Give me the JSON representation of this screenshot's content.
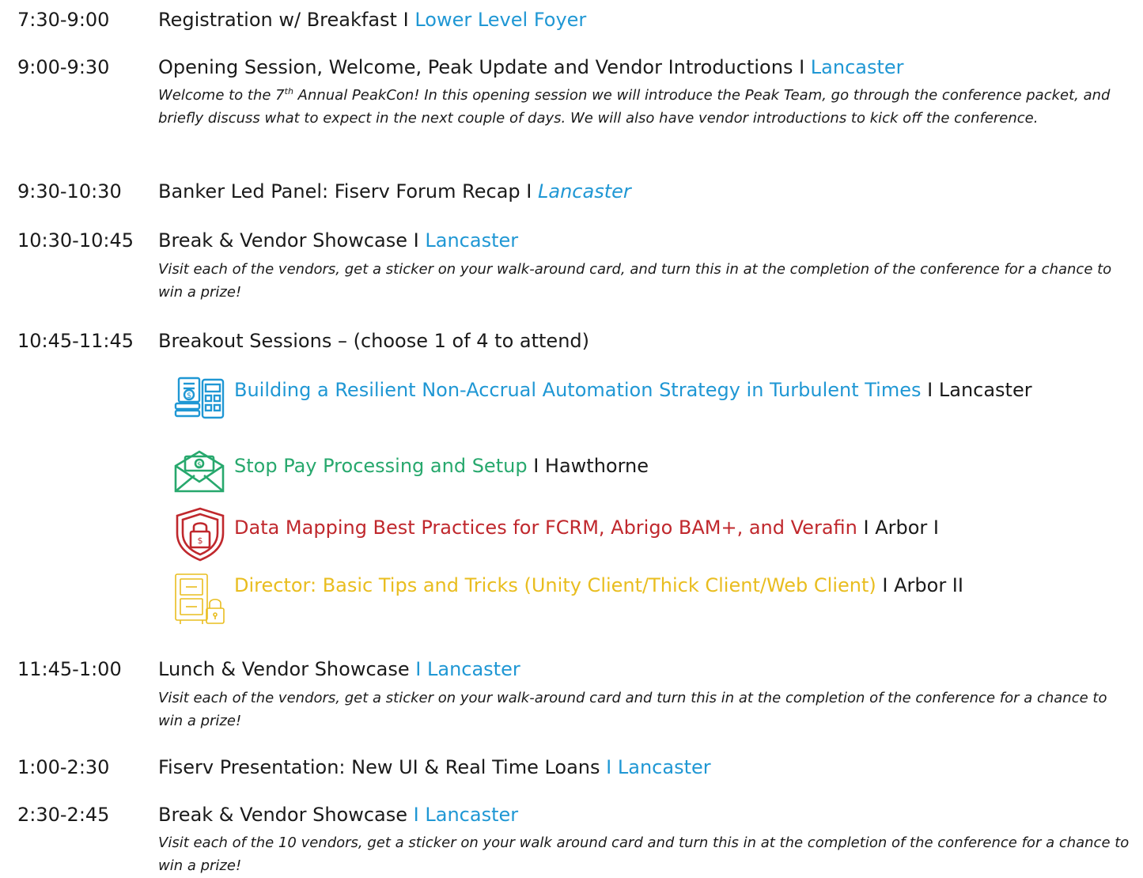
{
  "schedule": [
    {
      "time": "7:30-9:00",
      "title": "Registration w/ Breakfast",
      "sep": "I",
      "location": "Lower Level Foyer"
    },
    {
      "time": "9:00-9:30",
      "title": "Opening Session, Welcome, Peak Update and Vendor Introductions I",
      "location": "Lancaster",
      "desc_a": "Welcome to the 7",
      "desc_sup": "th",
      "desc_b": " Annual PeakCon!  In this opening session we will introduce the Peak Team, go through the conference packet, and briefly discuss what to expect in the next couple of days.  We will also have vendor introductions to kick off the conference."
    },
    {
      "time": "9:30-10:30",
      "title": "Banker Led Panel: Fiserv Forum Recap",
      "sep": "I",
      "location": "Lancaster"
    },
    {
      "time": "10:30-10:45",
      "title": "Break & Vendor Showcase",
      "sep": "I",
      "location": "Lancaster",
      "desc": "Visit each of the vendors, get a sticker on your walk-around card, and turn this in at the completion of the conference for a chance to win a prize!"
    },
    {
      "time": "10:45-11:45",
      "title": "Breakout Sessions – (choose 1 of 4 to attend)"
    },
    {
      "time": "11:45-1:00",
      "title": "Lunch & Vendor Showcase",
      "sep": "I",
      "location": "Lancaster",
      "desc": "Visit each of the vendors, get a sticker on your walk-around card and turn this in at the completion of the conference for a chance to win a prize!"
    },
    {
      "time": "1:00-2:30",
      "title": "Fiserv Presentation: New UI & Real Time Loans",
      "sep": "I",
      "location": "Lancaster"
    },
    {
      "time": "2:30-2:45",
      "title": "Break & Vendor Showcase",
      "sep": "I",
      "location": "Lancaster",
      "desc": "Visit each of the 10 vendors, get a sticker on your walk around card and turn this in at the completion of the conference for a chance to win a prize!"
    }
  ],
  "breakouts": [
    {
      "title": "Building a Resilient Non-Accrual Automation Strategy in Turbulent Times",
      "sep": "I",
      "room": "Lancaster",
      "icon": "calculator-documents-icon",
      "color": "#1f97d4"
    },
    {
      "title": "Stop Pay Processing and Setup",
      "sep": "I",
      "room": "Hawthorne",
      "icon": "money-envelope-icon",
      "color": "#27a86d"
    },
    {
      "title": "Data Mapping Best Practices for FCRM, Abrigo BAM+, and Verafin",
      "sep": "I",
      "room": "Arbor I",
      "icon": "security-shield-icon",
      "color": "#c0282d"
    },
    {
      "title": "Director: Basic Tips and Tricks (Unity Client/Thick Client/Web Client)",
      "sep": "I",
      "room": "Arbor II",
      "icon": "locked-cabinet-icon",
      "color": "#e9bd1f"
    }
  ]
}
